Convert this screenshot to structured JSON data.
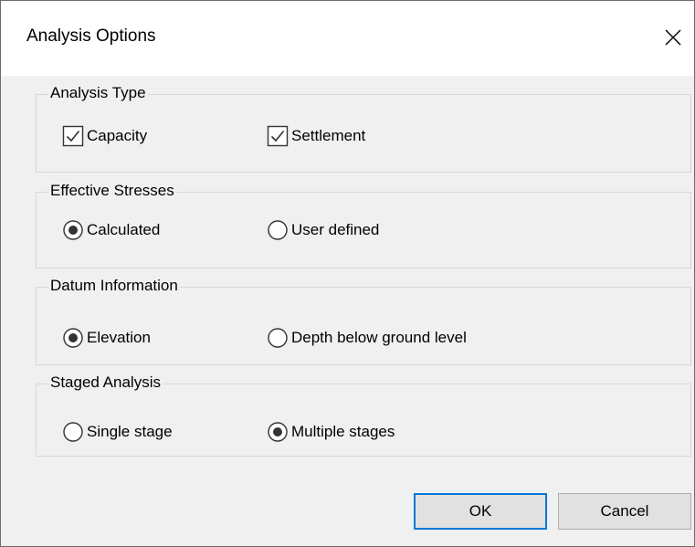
{
  "window": {
    "title": "Analysis Options",
    "close_icon": "close-icon"
  },
  "groups": {
    "analysis_type": {
      "legend": "Analysis Type",
      "capacity": {
        "label": "Capacity",
        "checked": true
      },
      "settlement": {
        "label": "Settlement",
        "checked": true
      }
    },
    "effective_stresses": {
      "legend": "Effective Stresses",
      "calculated": {
        "label": "Calculated",
        "selected": true
      },
      "user_defined": {
        "label": "User defined",
        "selected": false
      }
    },
    "datum_information": {
      "legend": "Datum Information",
      "elevation": {
        "label": "Elevation",
        "selected": true
      },
      "depth_below_ground": {
        "label": "Depth below ground level",
        "selected": false
      }
    },
    "staged_analysis": {
      "legend": "Staged Analysis",
      "single_stage": {
        "label": "Single stage",
        "selected": false
      },
      "multiple_stages": {
        "label": "Multiple stages",
        "selected": true
      }
    }
  },
  "buttons": {
    "ok": "OK",
    "cancel": "Cancel"
  },
  "colors": {
    "dialog_bg": "#f0f0f0",
    "titlebar_bg": "#ffffff",
    "group_border": "#d7d7d7",
    "default_button_border": "#0078d7"
  }
}
